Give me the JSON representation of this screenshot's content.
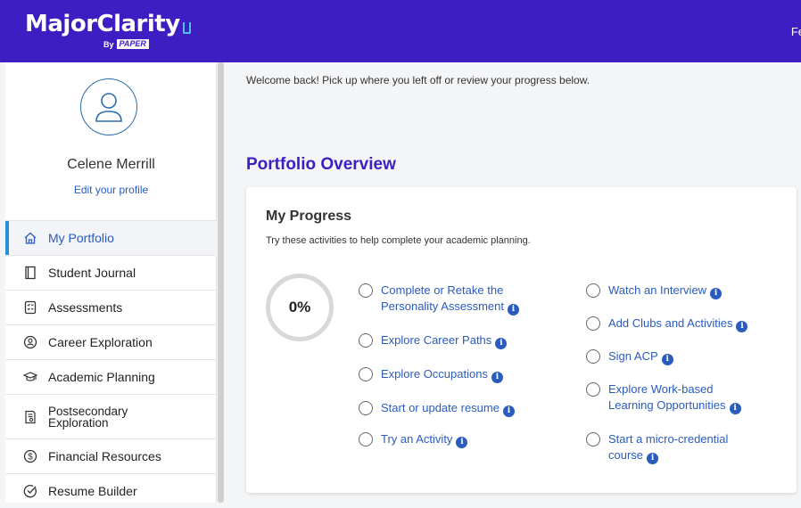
{
  "header": {
    "logo_text": "MajorClarity",
    "logo_by": "By",
    "logo_paper": "PAPER",
    "right_link": "Fe"
  },
  "sidebar": {
    "user_name": "Celene Merrill",
    "edit_profile": "Edit your profile",
    "items": [
      {
        "label": "My Portfolio",
        "icon": "home-icon",
        "active": true
      },
      {
        "label": "Student Journal",
        "icon": "journal-icon"
      },
      {
        "label": "Assessments",
        "icon": "assessment-icon"
      },
      {
        "label": "Career Exploration",
        "icon": "career-icon"
      },
      {
        "label": "Academic Planning",
        "icon": "graduation-cap-icon"
      },
      {
        "label": "Postsecondary Exploration",
        "icon": "postsecondary-icon"
      },
      {
        "label": "Financial Resources",
        "icon": "dollar-icon"
      },
      {
        "label": "Resume Builder",
        "icon": "check-circle-icon"
      }
    ]
  },
  "main": {
    "welcome": "Welcome back! Pick up where you left off or review your progress below.",
    "section_title": "Portfolio Overview",
    "progress": {
      "title": "My Progress",
      "subtitle": "Try these activities to help complete your academic planning.",
      "percent_label": "0%",
      "percent": 0,
      "left_activities": [
        {
          "line1": "Complete or Retake the",
          "line2": "Personality Assessment"
        },
        {
          "line1": "Explore Career Paths",
          "line2": ""
        },
        {
          "line1": "Explore Occupations",
          "line2": ""
        },
        {
          "line1": "Start or update resume",
          "line2": ""
        },
        {
          "line1": "Try an Activity",
          "line2": ""
        }
      ],
      "right_activities": [
        {
          "line1": "Watch an Interview",
          "line2": ""
        },
        {
          "line1": "Add Clubs and Activities",
          "line2": ""
        },
        {
          "line1": "Sign ACP",
          "line2": ""
        },
        {
          "line1": "Explore Work-based",
          "line2": "Learning Opportunities"
        },
        {
          "line1": "Start a micro-credential",
          "line2": "course"
        }
      ]
    }
  },
  "colors": {
    "brand": "#3d1ec3",
    "link": "#2a5bbf",
    "active_bar": "#2b8fd8"
  }
}
